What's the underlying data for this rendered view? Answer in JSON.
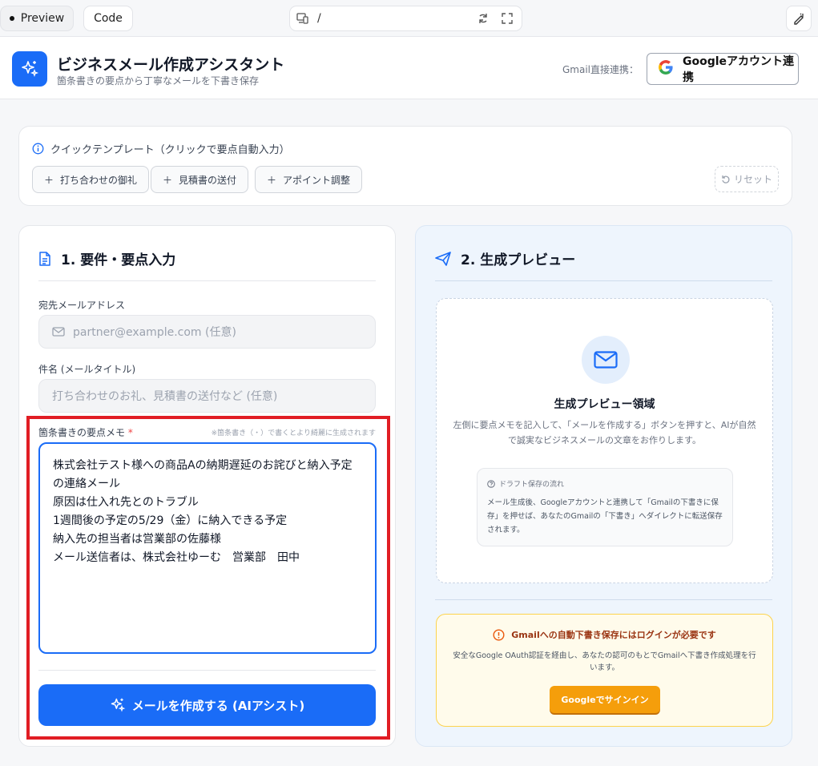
{
  "topbar": {
    "preview_label": "Preview",
    "code_label": "Code",
    "url_path": "/"
  },
  "header": {
    "title": "ビジネスメール作成アシスタント",
    "subtitle": "箇条書きの要点から丁寧なメールを下書き保存",
    "gmail_label": "Gmail直接連携：",
    "google_button": "Googleアカウント連携"
  },
  "templates": {
    "title": "クイックテンプレート（クリックで要点自動入力）",
    "items": [
      "打ち合わせの御礼",
      "見積書の送付",
      "アポイント調整"
    ],
    "reset_label": "リセット"
  },
  "input_panel": {
    "section_title": "1. 要件・要点入力",
    "to_label": "宛先メールアドレス",
    "to_placeholder": "partner@example.com (任意)",
    "subject_label": "件名 (メールタイトル)",
    "subject_placeholder": "打ち合わせのお礼、見積書の送付など (任意)",
    "memo_label": "箇条書きの要点メモ",
    "memo_required": "*",
    "memo_hint": "※箇条書き（・）で書くとより綺麗に生成されます",
    "memo_value": "株式会社テスト様への商品Aの納期遅延のお詫びと納入予定の連絡メール\n原因は仕入れ先とのトラブル\n1週間後の予定の5/29（金）に納入できる予定\n納入先の担当者は営業部の佐藤様\nメール送信者は、株式会社ゆーむ　営業部　田中",
    "generate_label": "メールを作成する (AIアシスト)"
  },
  "preview_panel": {
    "section_title": "2. 生成プレビュー",
    "area_title": "生成プレビュー領域",
    "area_desc": "左側に要点メモを記入して、「メールを作成する」ボタンを押すと、AIが自然で誠実なビジネスメールの文章をお作りします。",
    "flow_title": "ドラフト保存の流れ",
    "flow_desc": "メール生成後、Googleアカウントと連携して「Gmailの下書きに保存」を押せば、あなたのGmailの「下書き」へダイレクトに転送保存されます。",
    "login_title": "Gmailへの自動下書き保存にはログインが必要です",
    "login_desc": "安全なGoogle OAuth認証を経由し、あなたの認可のもとでGmailへ下書き作成処理を行います。",
    "signin_label": "Googleでサインイン"
  },
  "colors": {
    "accent": "#1a6cf7",
    "warning": "#f59e0b",
    "highlight": "#e11d24"
  }
}
